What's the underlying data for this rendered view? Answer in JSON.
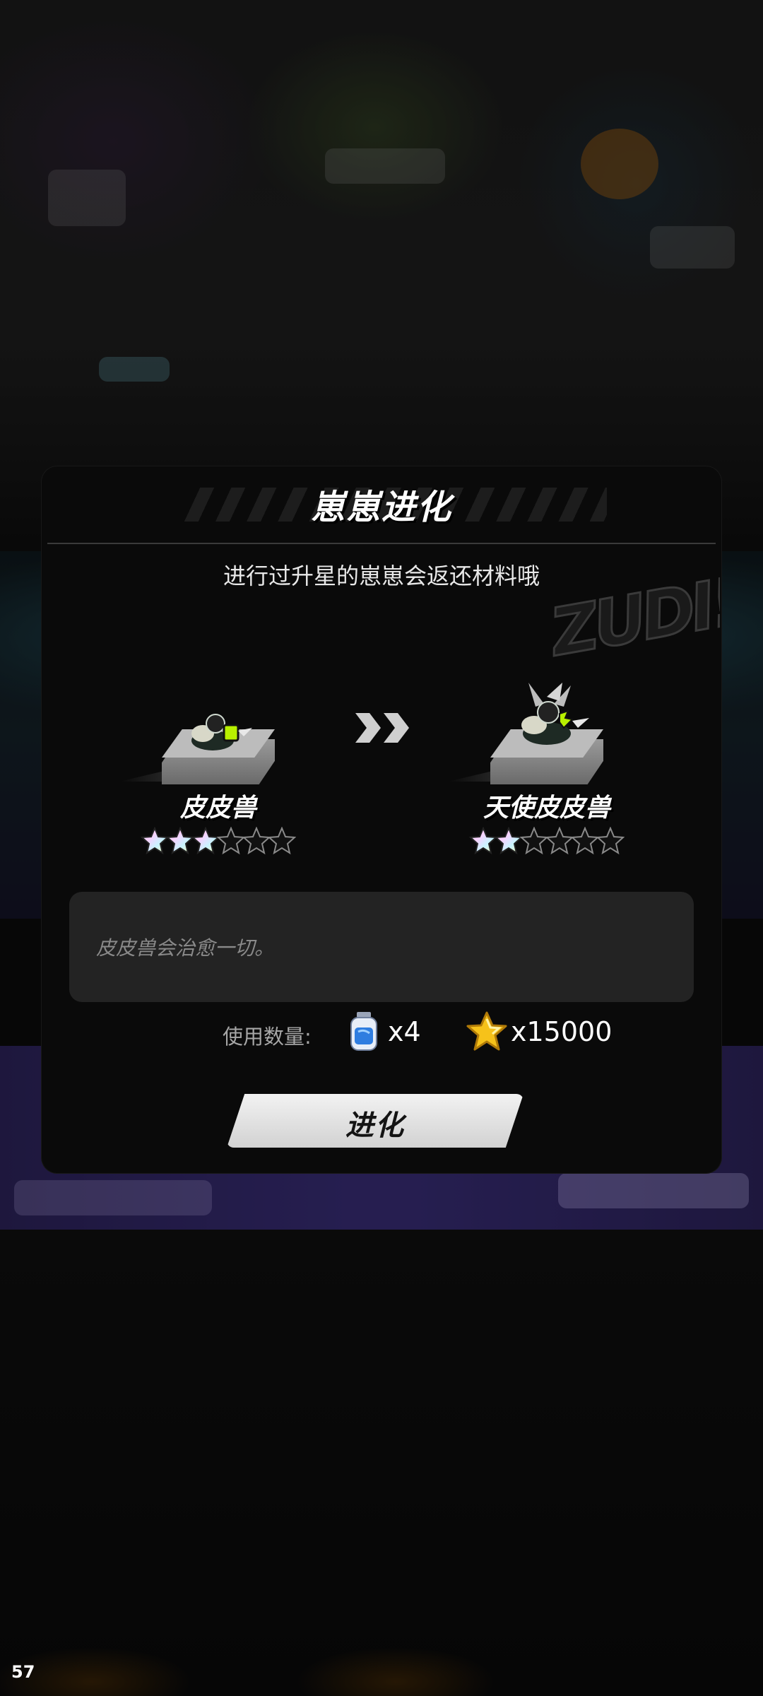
{
  "dialog": {
    "title": "崽崽进化",
    "subtitle": "进行过升星的崽崽会返还材料哦",
    "from_pet": {
      "name": "皮皮兽",
      "stars_filled": 3,
      "stars_total": 6
    },
    "to_pet": {
      "name": "天使皮皮兽",
      "stars_filled": 2,
      "stars_total": 6
    },
    "description": "皮皮兽会治愈一切。",
    "cost": {
      "label": "使用数量:",
      "bottle_count": "x4",
      "coin_count": "x15000",
      "bottle_icon": "evolution-potion-icon",
      "coin_icon": "gold-star-coin-icon"
    },
    "evolve_button": "进化"
  },
  "fps_counter": "57",
  "colors": {
    "dialog_bg": "#0a0a0a",
    "desc_box": "#232323",
    "accent_green": "#b8f000",
    "button_bg": "#e6e6e6"
  }
}
